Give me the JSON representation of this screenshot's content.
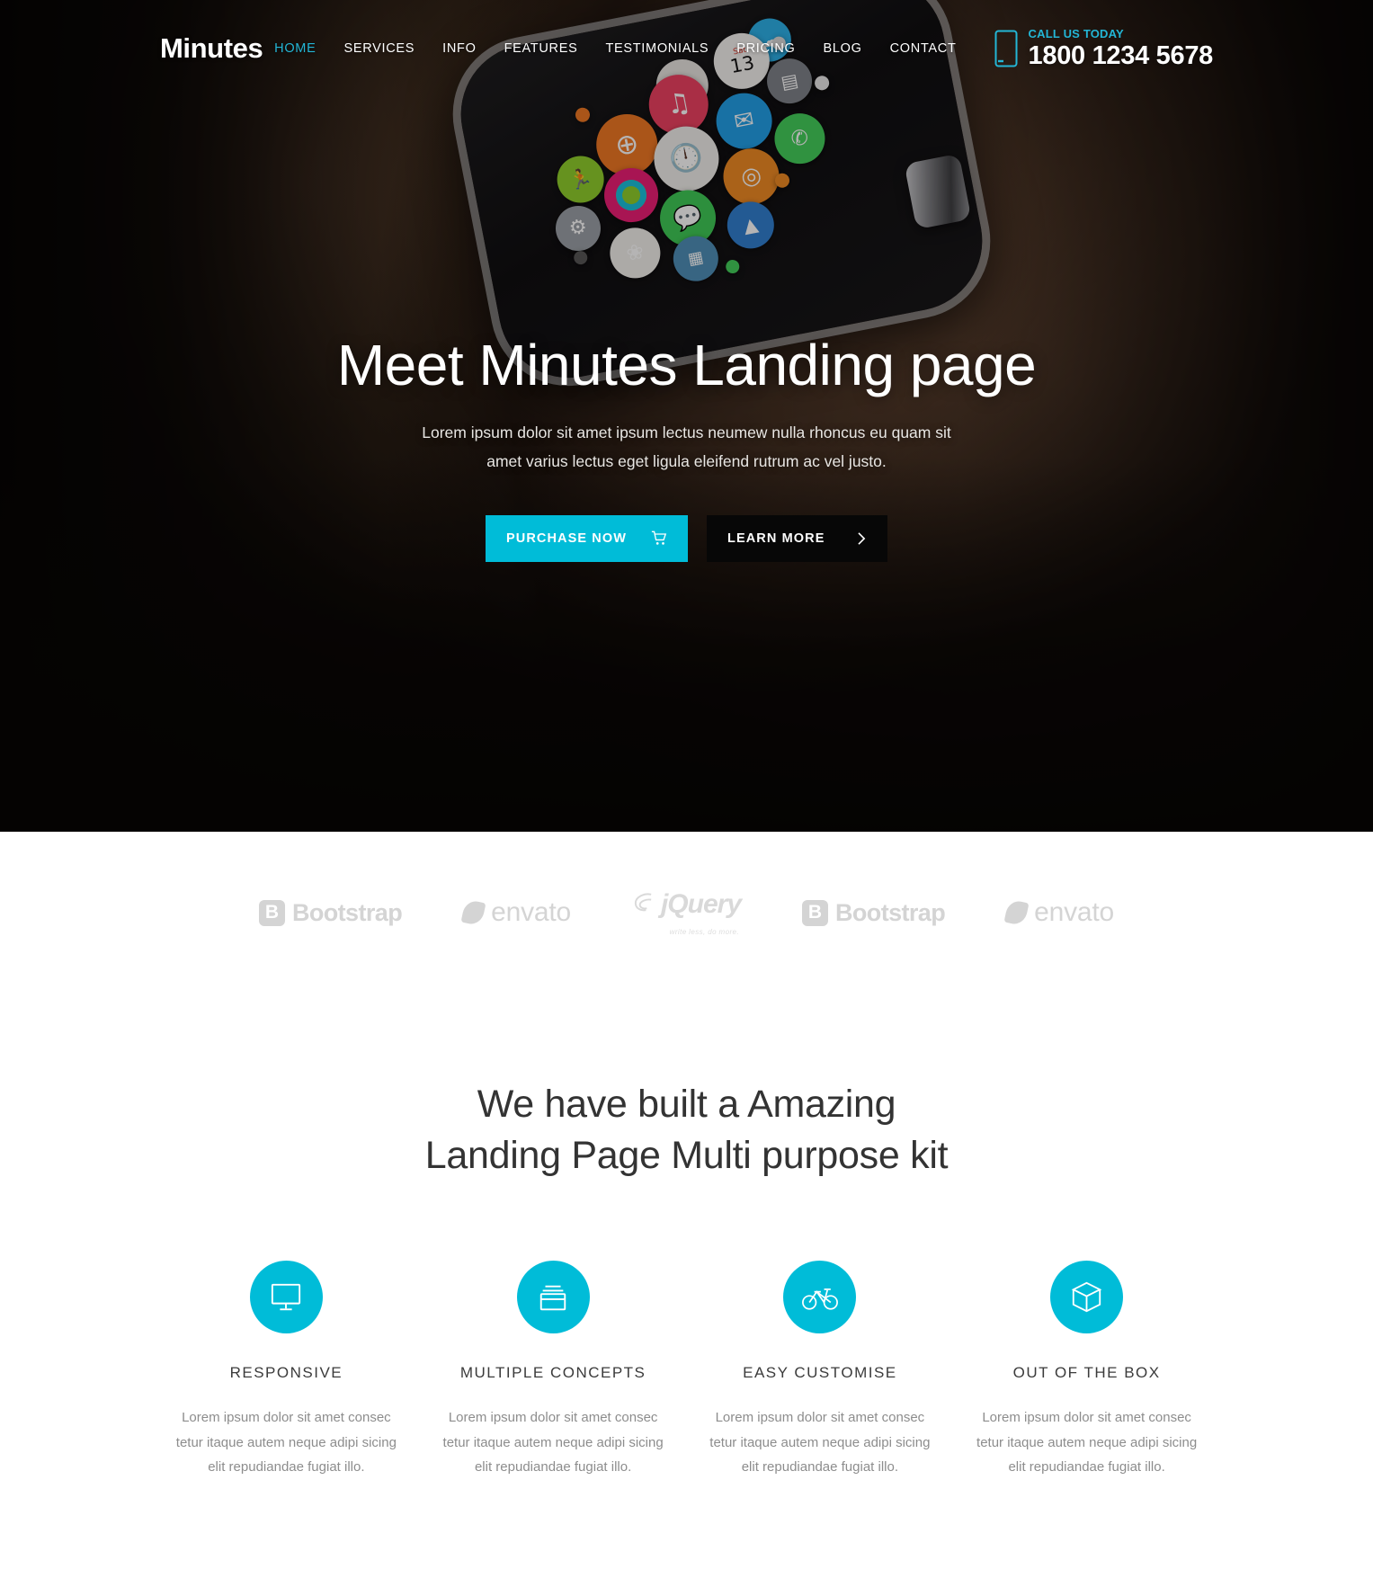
{
  "brand": {
    "logo": "Minutes"
  },
  "colors": {
    "accent": "#00bcd8",
    "nav_active": "#23b6d6",
    "dark_button": "#070707",
    "heading": "#333333",
    "body_text": "#8d8d8d",
    "logo_gray": "#d2d2d2"
  },
  "nav": {
    "items": [
      {
        "label": "HOME",
        "active": true
      },
      {
        "label": "SERVICES",
        "active": false
      },
      {
        "label": "INFO",
        "active": false
      },
      {
        "label": "FEATURES",
        "active": false
      },
      {
        "label": "TESTIMONIALS",
        "active": false
      },
      {
        "label": "PRICING",
        "active": false
      },
      {
        "label": "BLOG",
        "active": false
      },
      {
        "label": "CONTACT",
        "active": false
      }
    ]
  },
  "call": {
    "icon": "mobile-phone-icon",
    "label": "CALL US TODAY",
    "number": "1800 1234 5678"
  },
  "hero": {
    "title": "Meet Minutes Landing page",
    "subtitle_line1": "Lorem ipsum dolor sit amet ipsum lectus neumew nulla rhoncus eu quam sit",
    "subtitle_line2": "amet varius lectus eget ligula eleifend rutrum ac vel justo.",
    "primary_button": {
      "label": "PURCHASE NOW",
      "icon": "shopping-cart-icon"
    },
    "secondary_button": {
      "label": "LEARN MORE",
      "icon": "chevron-right-icon"
    },
    "background_description": "Smartwatch on a wrist showing a cluster of colourful app icons"
  },
  "logo_strip": {
    "brands": [
      {
        "name": "Bootstrap",
        "mark": "bootstrap-b-icon"
      },
      {
        "name": "envato",
        "mark": "envato-leaf-icon"
      },
      {
        "name": "jQuery",
        "mark": "jquery-swirl-icon",
        "tagline": "write less, do more."
      },
      {
        "name": "Bootstrap",
        "mark": "bootstrap-b-icon"
      },
      {
        "name": "envato",
        "mark": "envato-leaf-icon"
      }
    ]
  },
  "features": {
    "heading_line1": "We have built a Amazing",
    "heading_line2": "Landing Page Multi purpose kit",
    "items": [
      {
        "icon": "monitor-icon",
        "title": "RESPONSIVE",
        "text": "Lorem ipsum dolor sit amet consec tetur itaque autem neque adipi sicing elit repudiandae fugiat illo."
      },
      {
        "icon": "layers-window-icon",
        "title": "MULTIPLE CONCEPTS",
        "text": "Lorem ipsum dolor sit amet consec tetur itaque autem neque adipi sicing elit repudiandae fugiat illo."
      },
      {
        "icon": "bicycle-icon",
        "title": "EASY CUSTOMISE",
        "text": "Lorem ipsum dolor sit amet consec tetur itaque autem neque adipi sicing elit repudiandae fugiat illo."
      },
      {
        "icon": "cube-box-icon",
        "title": "OUT OF THE BOX",
        "text": "Lorem ipsum dolor sit amet consec tetur itaque autem neque adipi sicing elit repudiandae fugiat illo."
      }
    ]
  }
}
